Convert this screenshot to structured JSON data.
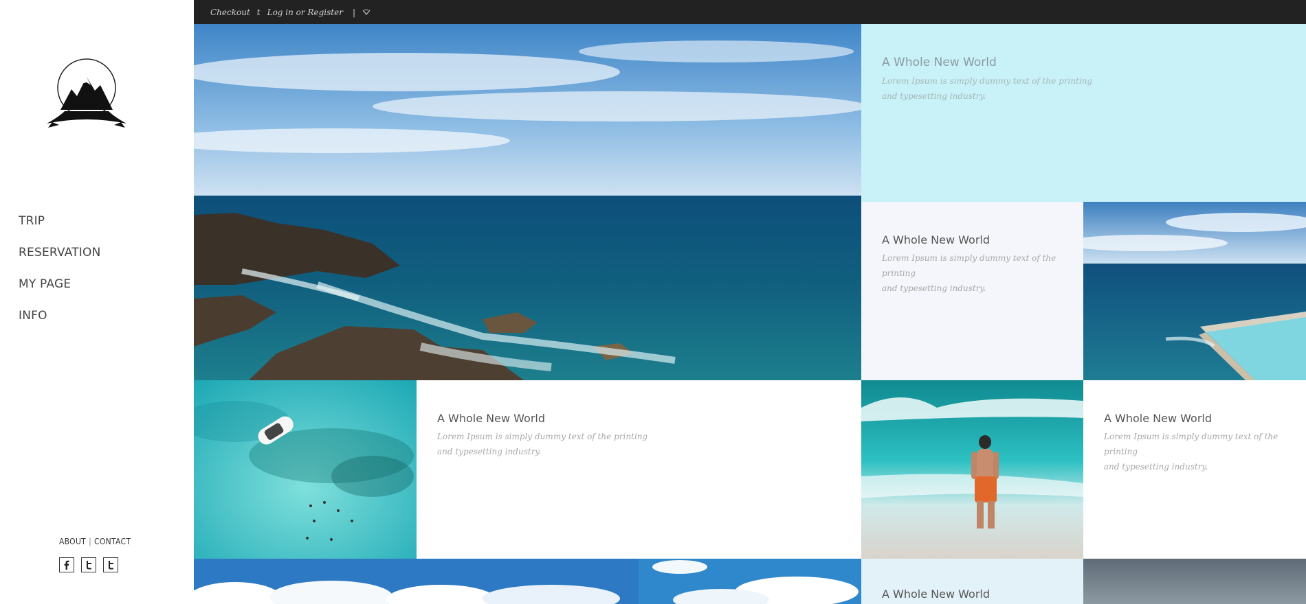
{
  "topbar": {
    "checkout": "Checkout",
    "t": "t",
    "login": "Log in or Register",
    "divider": "|"
  },
  "sidebar": {
    "nav": [
      {
        "label": "TRIP"
      },
      {
        "label": "RESERVATION"
      },
      {
        "label": "MY PAGE"
      },
      {
        "label": "INFO"
      }
    ],
    "footer": {
      "about": "ABOUT",
      "separator": "|",
      "contact": "CONTACT"
    },
    "social": [
      "facebook-icon",
      "twitter-icon",
      "twitter-icon"
    ]
  },
  "cards": [
    {
      "title": "A Whole New World",
      "line1": "Lorem Ipsum is simply dummy text of the printing",
      "line2": "and typesetting industry."
    },
    {
      "title": "A Whole New World",
      "line1": "Lorem Ipsum is simply dummy text of the",
      "line1b": "printing",
      "line2": "and typesetting industry."
    },
    {
      "title": "A Whole New World",
      "line1": "Lorem Ipsum is simply dummy text of the printing",
      "line2": "and typesetting industry."
    },
    {
      "title": "A Whole New World",
      "line1": "Lorem Ipsum is simply dummy text of the",
      "line1b": "printing",
      "line2": "and typesetting industry."
    },
    {
      "title": "A Whole New World"
    }
  ],
  "colors": {
    "topbar_bg": "#222222",
    "card_cyan": "#c8f2f7",
    "card_lavender": "#f5f6fb",
    "card_lightblue": "#e3f1f8"
  }
}
